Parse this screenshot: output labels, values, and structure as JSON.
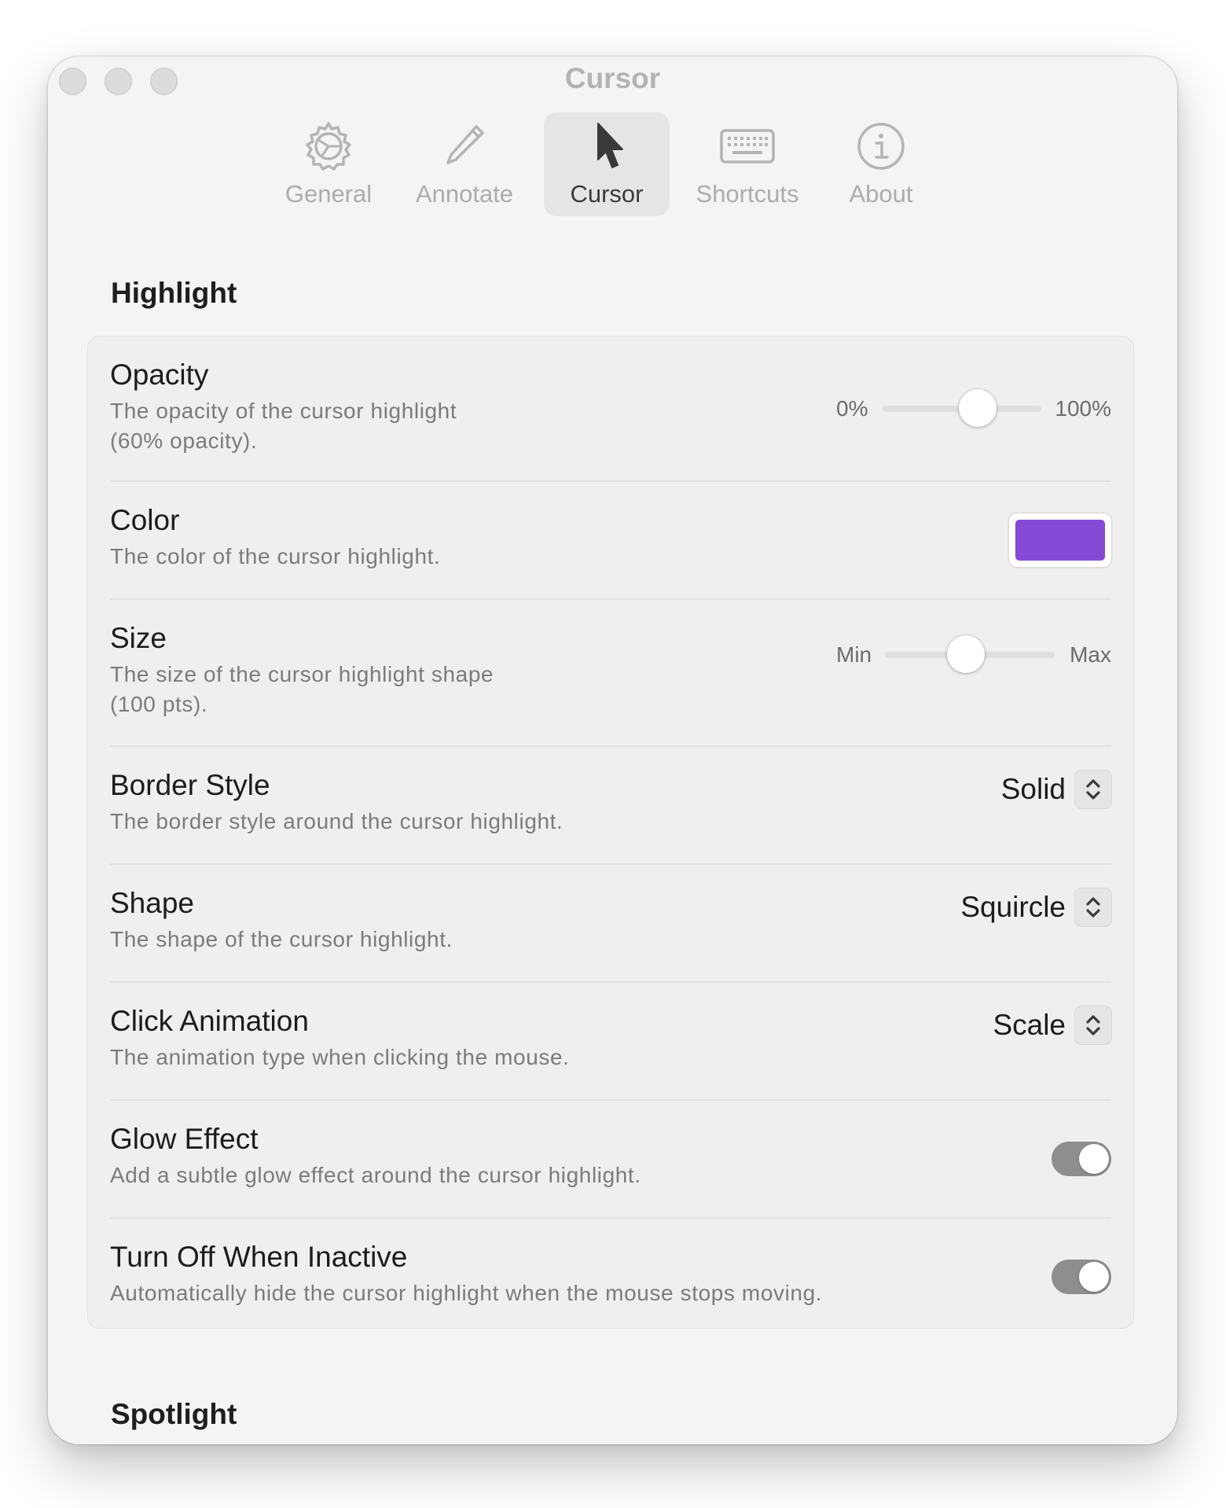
{
  "window": {
    "title": "Cursor",
    "traffic_lights": [
      "close-button",
      "minimize-button",
      "zoom-button"
    ]
  },
  "toolbar": {
    "selected": "Cursor",
    "tabs": [
      {
        "label": "General",
        "icon": "gear-icon"
      },
      {
        "label": "Annotate",
        "icon": "pencil-icon"
      },
      {
        "label": "Cursor",
        "icon": "cursor-arrow-icon"
      },
      {
        "label": "Shortcuts",
        "icon": "keyboard-icon"
      },
      {
        "label": "About",
        "icon": "info-icon"
      }
    ]
  },
  "highlight": {
    "section_title": "Highlight",
    "opacity": {
      "title": "Opacity",
      "description_line1": "The opacity of the cursor highlight",
      "description_line2": "(60% opacity).",
      "min_label": "0%",
      "max_label": "100%",
      "value": 0.6
    },
    "color": {
      "title": "Color",
      "description": "The color of the cursor highlight.",
      "value": "#8549d6"
    },
    "size": {
      "title": "Size",
      "description_line1": "The size of the cursor highlight shape",
      "description_line2": "(100 pts).",
      "min_label": "Min",
      "max_label": "Max",
      "value": 100
    },
    "border_style": {
      "title": "Border Style",
      "description": "The border style around the cursor highlight.",
      "value": "Solid"
    },
    "shape": {
      "title": "Shape",
      "description": "The shape of the cursor highlight.",
      "value": "Squircle"
    },
    "click_animation": {
      "title": "Click Animation",
      "description": "The animation type when clicking the mouse.",
      "value": "Scale"
    },
    "glow_effect": {
      "title": "Glow Effect",
      "description": "Add a subtle glow effect around the cursor highlight.",
      "on": true
    },
    "turn_off_inactive": {
      "title": "Turn Off When Inactive",
      "description": "Automatically hide the cursor highlight when the mouse stops moving.",
      "on": true
    }
  },
  "spotlight": {
    "section_title": "Spotlight"
  }
}
